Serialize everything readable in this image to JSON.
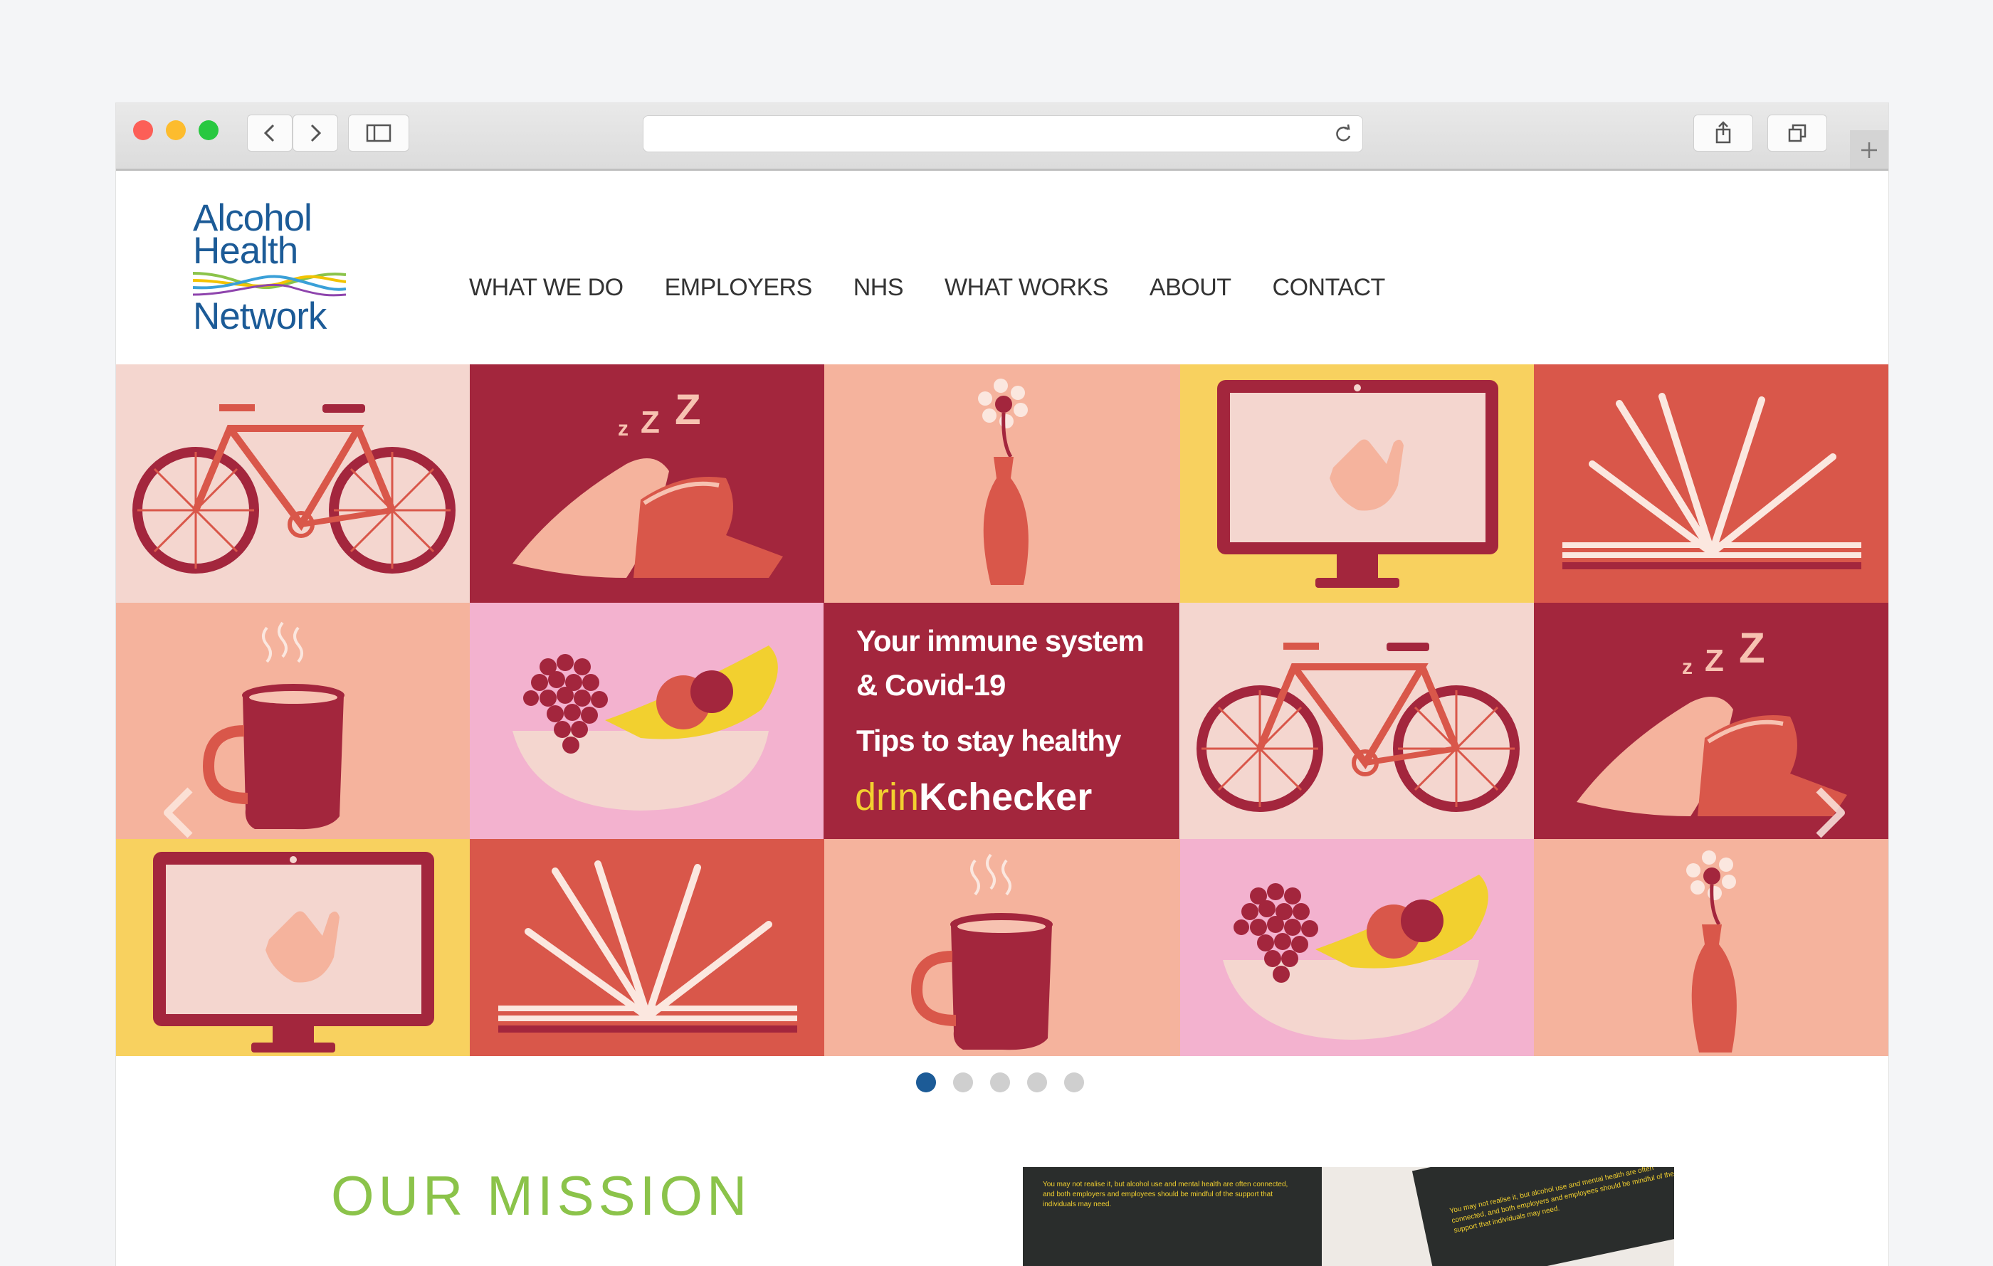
{
  "site": {
    "logo_words": [
      "Alcohol",
      "Health",
      "Network"
    ],
    "logo_wave_colors": [
      "#8bc34a",
      "#f2c300",
      "#3aa0d8",
      "#8e44ad"
    ]
  },
  "nav": {
    "items": [
      {
        "label": "WHAT WE DO"
      },
      {
        "label": "EMPLOYERS"
      },
      {
        "label": "NHS"
      },
      {
        "label": "WHAT WORKS"
      },
      {
        "label": "ABOUT"
      },
      {
        "label": "CONTACT"
      }
    ]
  },
  "hero": {
    "promo": {
      "line1": "Your immune system",
      "line2": "& Covid-19",
      "line3": "Tips to stay healthy",
      "brand_part1": "drin",
      "brand_part2": "K",
      "brand_part3": "checker"
    },
    "tiles": [
      {
        "icon": "bicycle-icon",
        "bg": "#f4d6cf"
      },
      {
        "icon": "pillow-sleep-icon",
        "bg": "#a3263d"
      },
      {
        "icon": "flower-vase-icon",
        "bg": "#f5b39d"
      },
      {
        "icon": "monitor-wave-icon",
        "bg": "#f8d15f"
      },
      {
        "icon": "open-book-icon",
        "bg": "#d9574a"
      },
      {
        "icon": "coffee-mug-icon",
        "bg": "#f5b39d"
      },
      {
        "icon": "fruit-bowl-icon",
        "bg": "#f3b2cf"
      },
      {
        "icon": "bicycle-icon",
        "bg": "#f4d6cf"
      },
      {
        "icon": "pillow-sleep-icon",
        "bg": "#a3263d"
      },
      {
        "icon": "monitor-wave-icon",
        "bg": "#f8d15f"
      },
      {
        "icon": "open-book-icon",
        "bg": "#d9574a"
      },
      {
        "icon": "coffee-mug-icon",
        "bg": "#f5b39d"
      },
      {
        "icon": "fruit-bowl-icon",
        "bg": "#f3b2cf"
      },
      {
        "icon": "flower-vase-icon",
        "bg": "#f5b39d"
      }
    ],
    "slide_count": 5,
    "active_slide": 1
  },
  "mission": {
    "heading": "OUR MISSION",
    "image_text_1": "You may not realise it, but alcohol use and mental health are often connected, and both employers and employees should be mindful of the support that individuals may need.",
    "image_text_2": "You may not realise it, but alcohol use and mental health are often connected, and both employers and employees should be mindful of the support that individuals may need."
  },
  "colors": {
    "brand_blue": "#1c5b97",
    "mission_green": "#8bc34a",
    "burgundy": "#a3263d",
    "brand_yellow": "#f2d02f"
  }
}
